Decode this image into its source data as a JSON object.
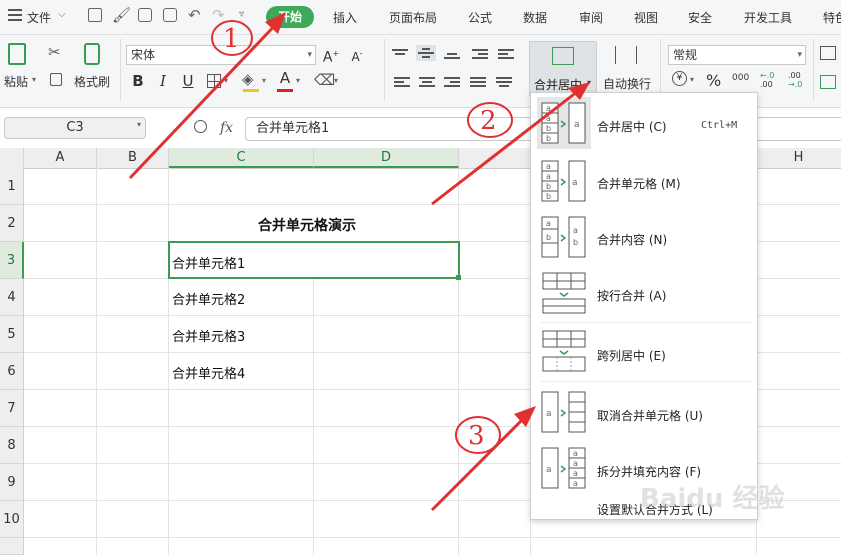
{
  "menubar": {
    "file_label": "文件",
    "tabs": [
      "开始",
      "插入",
      "页面布局",
      "公式",
      "数据",
      "审阅",
      "视图",
      "安全",
      "开发工具",
      "特色"
    ]
  },
  "ribbon": {
    "paste_label": "粘贴",
    "format_painter_label": "格式刷",
    "font_name": "宋体",
    "merge_center_label": "合并居中",
    "wrap_label": "自动换行",
    "number_format": "常规",
    "bold": "B",
    "italic": "I",
    "underline": "U",
    "font_color_glyph": "A",
    "grow_font": "A⁺",
    "shrink_font": "A⁻",
    "percent": "%",
    "thousands": "000",
    "inc_decimal": "+.0\n.00",
    "dec_decimal": ".00\n→.0"
  },
  "formula_bar": {
    "name_box": "C3",
    "fx": "fx",
    "value": "合并单元格1"
  },
  "grid": {
    "columns": [
      "A",
      "B",
      "C",
      "D",
      "",
      "",
      "",
      "H"
    ],
    "rows": [
      "1",
      "2",
      "3",
      "4",
      "5",
      "6",
      "7",
      "8",
      "9",
      "10"
    ],
    "title_cell": "合并单元格演示",
    "cells": [
      "合并单元格1",
      "合并单元格2",
      "合并单元格3",
      "合并单元格4"
    ]
  },
  "dropdown": {
    "items": [
      {
        "label": "合并居中 (C)",
        "shortcut": "Ctrl+M"
      },
      {
        "label": "合并单元格 (M)",
        "shortcut": ""
      },
      {
        "label": "合并内容 (N)",
        "shortcut": ""
      },
      {
        "label": "按行合并 (A)",
        "shortcut": ""
      },
      {
        "label": "跨列居中 (E)",
        "shortcut": ""
      },
      {
        "label": "取消合并单元格 (U)",
        "shortcut": ""
      },
      {
        "label": "拆分并填充内容 (F)",
        "shortcut": ""
      },
      {
        "label": "设置默认合并方式 (L)",
        "shortcut": ""
      }
    ]
  },
  "annotations": {
    "markers": [
      "1",
      "2",
      "3"
    ],
    "color": "#e03030"
  },
  "watermark": "Baidu 经验",
  "colors": {
    "accent_green": "#3fa95a",
    "selection_green": "#3c9a55",
    "annotation_red": "#e03030"
  }
}
